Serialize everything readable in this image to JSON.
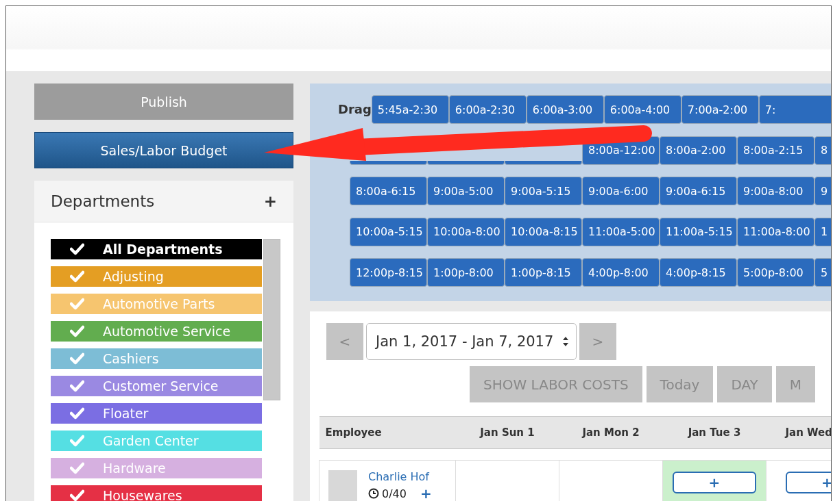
{
  "sidebar": {
    "publish_button": "Publish",
    "budget_button": "Sales/Labor Budget",
    "departments": {
      "title": "Departments",
      "add_icon": "+",
      "items": [
        {
          "label": "All Departments",
          "color": "#000000",
          "checked": true,
          "bold": true
        },
        {
          "label": "Adjusting",
          "color": "#e49e23",
          "checked": true,
          "bold": false
        },
        {
          "label": "Automotive Parts",
          "color": "#f6c56f",
          "checked": true,
          "bold": false
        },
        {
          "label": "Automotive Service",
          "color": "#62ad4f",
          "checked": true,
          "bold": false
        },
        {
          "label": "Cashiers",
          "color": "#7dbdd6",
          "checked": true,
          "bold": false
        },
        {
          "label": "Customer Service",
          "color": "#9a89e2",
          "checked": true,
          "bold": false
        },
        {
          "label": "Floater",
          "color": "#7b6ee3",
          "checked": true,
          "bold": false
        },
        {
          "label": "Garden Center",
          "color": "#55dfe3",
          "checked": true,
          "bold": false
        },
        {
          "label": "Hardware",
          "color": "#d6b0e0",
          "checked": true,
          "bold": false
        },
        {
          "label": "Housewares",
          "color": "#e53045",
          "checked": true,
          "bold": false
        }
      ]
    }
  },
  "shift_templates": {
    "title": "Drag",
    "rows": [
      [
        {
          "kind": "shift",
          "label": "5:45a-2:30"
        },
        {
          "kind": "shift",
          "label": "6:00a-2:30"
        },
        {
          "kind": "shift",
          "label": "6:00a-3:00"
        },
        {
          "kind": "shift",
          "label": "6:00a-4:00"
        },
        {
          "kind": "shift",
          "label": "7:00a-2:00"
        },
        {
          "kind": "shift",
          "label": "7:"
        }
      ],
      [
        {
          "kind": "covered"
        },
        {
          "kind": "covered"
        },
        {
          "kind": "covered"
        },
        {
          "kind": "shift",
          "label": "8:00a-12:00"
        },
        {
          "kind": "shift",
          "label": "8:00a-2:00"
        },
        {
          "kind": "shift",
          "label": "8:00a-2:15"
        },
        {
          "kind": "shift",
          "label": "8"
        }
      ],
      [
        {
          "kind": "shift",
          "label": "8:00a-6:15"
        },
        {
          "kind": "shift",
          "label": "9:00a-5:00"
        },
        {
          "kind": "shift",
          "label": "9:00a-5:15"
        },
        {
          "kind": "shift",
          "label": "9:00a-6:00"
        },
        {
          "kind": "shift",
          "label": "9:00a-6:15"
        },
        {
          "kind": "shift",
          "label": "9:00a-8:00"
        },
        {
          "kind": "shift",
          "label": "9"
        }
      ],
      [
        {
          "kind": "shift",
          "label": "10:00a-5:15"
        },
        {
          "kind": "shift",
          "label": "10:00a-8:00"
        },
        {
          "kind": "shift",
          "label": "10:00a-8:15"
        },
        {
          "kind": "shift",
          "label": "11:00a-5:00"
        },
        {
          "kind": "shift",
          "label": "11:00a-5:15"
        },
        {
          "kind": "shift",
          "label": "11:00a-8:00"
        },
        {
          "kind": "shift",
          "label": "1"
        }
      ],
      [
        {
          "kind": "shift",
          "label": "12:00p-8:15"
        },
        {
          "kind": "shift",
          "label": "1:00p-8:00"
        },
        {
          "kind": "shift",
          "label": "1:00p-8:15"
        },
        {
          "kind": "shift",
          "label": "4:00p-8:00"
        },
        {
          "kind": "shift",
          "label": "4:00p-8:15"
        },
        {
          "kind": "shift",
          "label": "5:00p-8:00"
        },
        {
          "kind": "shift",
          "label": "5"
        }
      ]
    ]
  },
  "schedule": {
    "prev_button": "<",
    "date_range": "Jan 1, 2017 - Jan 7, 2017",
    "next_button": ">",
    "view_buttons": [
      "SHOW LABOR COSTS",
      "Today",
      "DAY",
      "M"
    ],
    "table": {
      "columns": [
        "Employee",
        "Jan Sun 1",
        "Jan Mon 2",
        "Jan Tue 3",
        "Jan Wed"
      ],
      "rows": [
        {
          "cells": [
            {
              "kind": "employee",
              "name": "Charlie Hof",
              "hours": "0/40",
              "add_icon": "+"
            },
            {
              "kind": "day",
              "highlighted": false
            },
            {
              "kind": "day",
              "highlighted": false
            },
            {
              "kind": "day",
              "highlighted": true,
              "add_button": "+"
            },
            {
              "kind": "day",
              "highlighted": false,
              "add_button": "+"
            }
          ]
        }
      ]
    }
  }
}
